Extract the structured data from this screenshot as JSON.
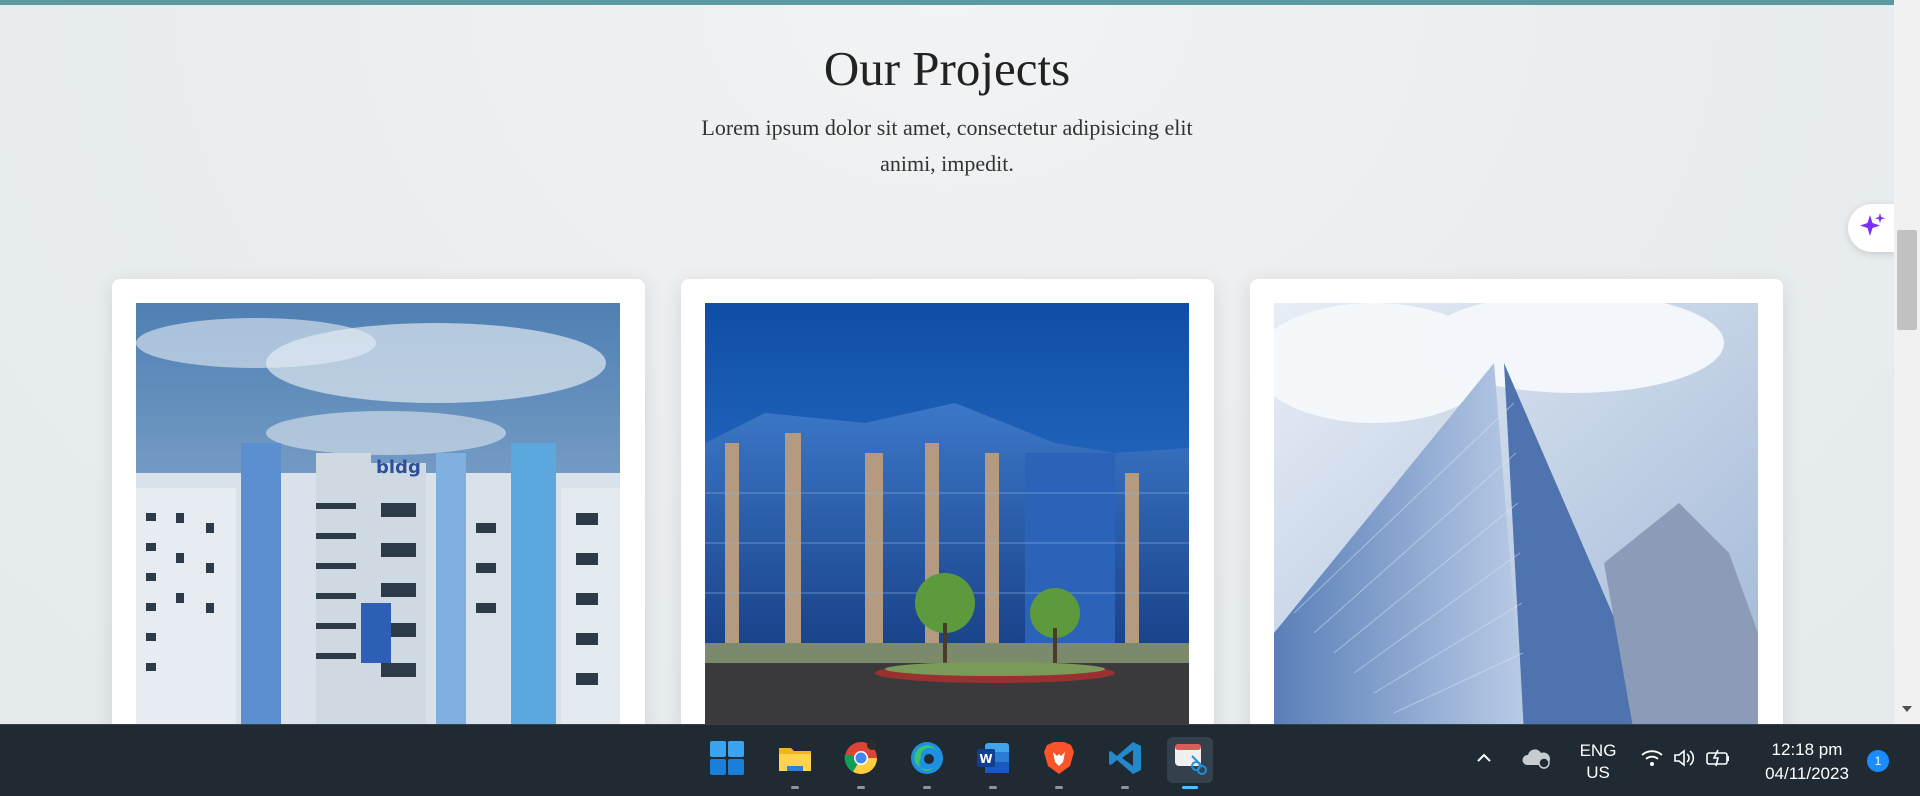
{
  "section": {
    "title": "Our Projects",
    "subtitle": "Lorem ipsum dolor sit amet, consectetur adipisicing elit animi, impedit."
  },
  "projects": [
    {
      "image": "blue-white-apartment-tower"
    },
    {
      "image": "glass-office-building"
    },
    {
      "image": "glass-skyscraper-looking-up"
    }
  ],
  "taskbar": {
    "apps": [
      "start",
      "file-explorer",
      "chrome",
      "edge",
      "word",
      "brave",
      "vscode",
      "snipping-tool"
    ],
    "active_app": "snipping-tool",
    "language_line1": "ENG",
    "language_line2": "US",
    "time": "12:18 pm",
    "date": "04/11/2023",
    "notification_count": "1"
  },
  "colors": {
    "accent_top_bar": "#5a9aa0",
    "taskbar_bg": "#1f2a33",
    "ai_sparkle": "#7b2ff7"
  }
}
